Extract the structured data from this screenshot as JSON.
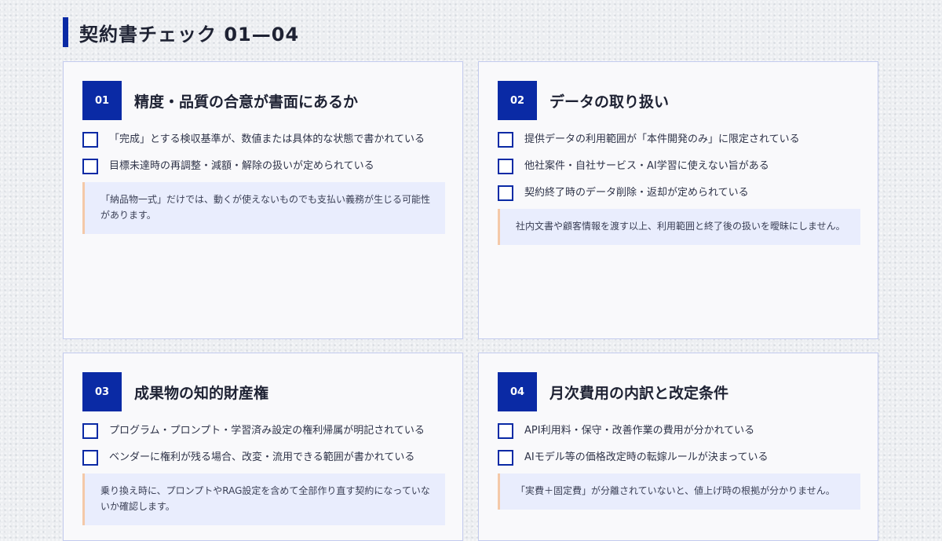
{
  "header": {
    "title": "契約書チェック 01—04"
  },
  "cards": [
    {
      "number": "01",
      "title": "精度・品質の合意が書面にあるか",
      "items": [
        "「完成」とする検収基準が、数値または具体的な状態で書かれている",
        "目標未達時の再調整・減額・解除の扱いが定められている"
      ],
      "note": "「納品物一式」だけでは、動くが使えないものでも支払い義務が生じる可能性があります。"
    },
    {
      "number": "02",
      "title": "データの取り扱い",
      "items": [
        "提供データの利用範囲が「本件開発のみ」に限定されている",
        "他社案件・自社サービス・AI学習に使えない旨がある",
        "契約終了時のデータ削除・返却が定められている"
      ],
      "note": "社内文書や顧客情報を渡す以上、利用範囲と終了後の扱いを曖昧にしません。"
    },
    {
      "number": "03",
      "title": "成果物の知的財産権",
      "items": [
        "プログラム・プロンプト・学習済み設定の権利帰属が明記されている",
        "ベンダーに権利が残る場合、改変・流用できる範囲が書かれている"
      ],
      "note": "乗り換え時に、プロンプトやRAG設定を含めて全部作り直す契約になっていないか確認します。"
    },
    {
      "number": "04",
      "title": "月次費用の内訳と改定条件",
      "items": [
        "API利用料・保守・改善作業の費用が分かれている",
        "AIモデル等の価格改定時の転嫁ルールが決まっている"
      ],
      "note": "「実費＋固定費」が分離されていないと、値上げ時の根拠が分かりません。"
    }
  ]
}
